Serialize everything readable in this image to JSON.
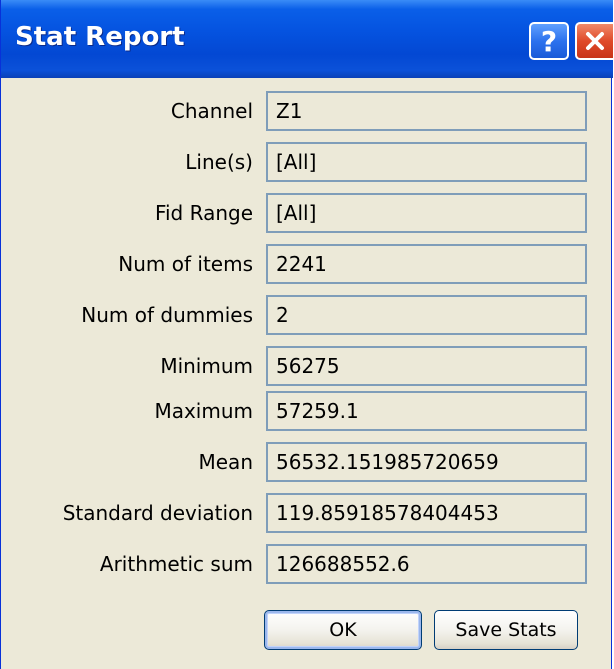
{
  "window": {
    "title": "Stat Report",
    "help_glyph": "?",
    "colors": {
      "titlebar": "#0553e0",
      "body": "#ece9d8",
      "field_border": "#7f9db9",
      "close_button": "#e04a2a"
    }
  },
  "fields": [
    {
      "label": "Channel",
      "value": "Z1"
    },
    {
      "label": "Line(s)",
      "value": "[All]"
    },
    {
      "label": "Fid Range",
      "value": "[All]"
    },
    {
      "label": "Num of items",
      "value": "2241"
    },
    {
      "label": "Num of dummies",
      "value": "2"
    },
    {
      "label": "Minimum",
      "value": "56275"
    },
    {
      "label": "Maximum",
      "value": "57259.1"
    },
    {
      "label": "Mean",
      "value": "56532.151985720659"
    },
    {
      "label": "Standard deviation",
      "value": "119.85918578404453"
    },
    {
      "label": "Arithmetic sum",
      "value": "126688552.6"
    }
  ],
  "buttons": {
    "ok_label": "OK",
    "save_label": "Save Stats"
  },
  "icons": {
    "help": "help-icon",
    "close": "close-icon"
  }
}
